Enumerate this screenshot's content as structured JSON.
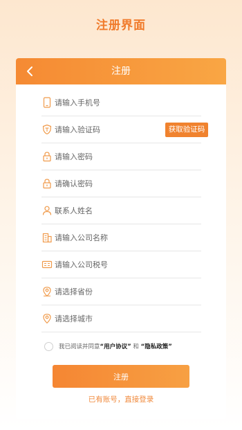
{
  "page": {
    "title": "注册界面"
  },
  "header": {
    "title": "注册"
  },
  "form": {
    "phone_placeholder": "请输入手机号",
    "code_placeholder": "请输入验证码",
    "code_button": "获取验证码",
    "password_placeholder": "请输入密码",
    "confirm_placeholder": "请确认密码",
    "contact_placeholder": "联系人姓名",
    "company_placeholder": "请输入公司名称",
    "tax_placeholder": "请输入公司税号",
    "province_placeholder": "请选择省份",
    "city_placeholder": "请选择城市"
  },
  "agreement": {
    "prefix": "我已阅读并同意",
    "user_agreement": "“用户协议”",
    "and": "和",
    "privacy_policy": "“隐私政策”"
  },
  "actions": {
    "submit": "注册",
    "login_link": "已有账号，直接登录"
  },
  "icons": {
    "back": "back-arrow-icon",
    "phone": "phone-icon",
    "shield": "shield-icon",
    "lock": "lock-icon",
    "person": "person-icon",
    "building": "building-icon",
    "tax": "tax-id-icon",
    "location": "location-pin-icon"
  },
  "colors": {
    "accent": "#f0822e",
    "icon": "#f09a4a",
    "title": "#f07a2a"
  }
}
